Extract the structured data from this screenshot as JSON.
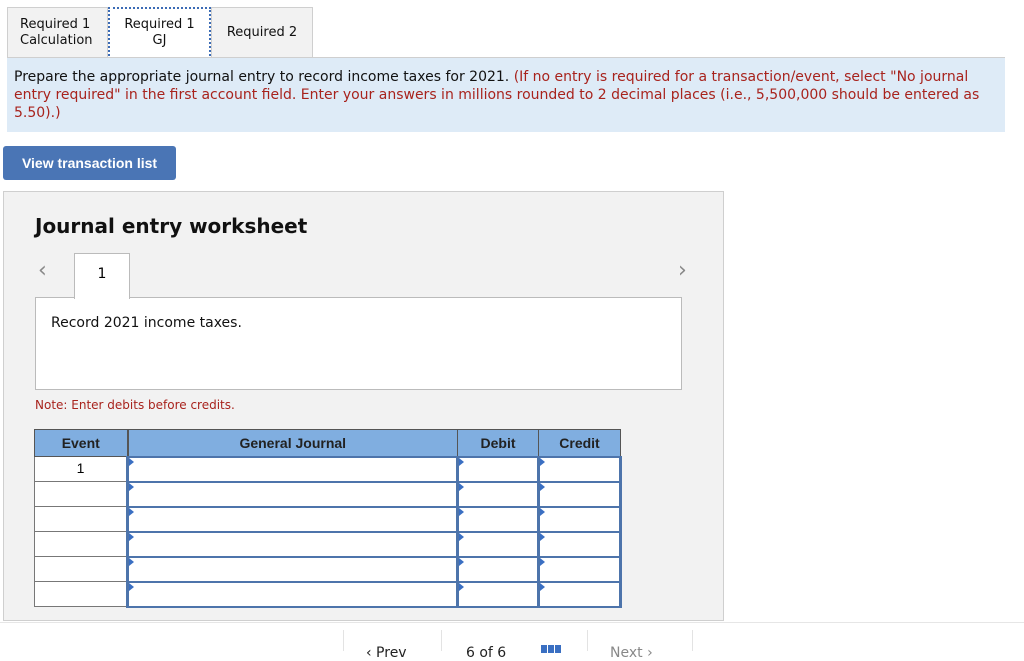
{
  "tabs": [
    {
      "label": "Required 1 Calculation",
      "active": false
    },
    {
      "label": "Required 1 GJ",
      "active": true
    },
    {
      "label": "Required 2",
      "active": false
    }
  ],
  "instructions": {
    "main": "Prepare the appropriate journal entry to record income taxes for 2021.",
    "note": "(If no entry is required for a transaction/event, select \"No journal entry required\" in the first account field. Enter your answers in millions rounded to 2 decimal places (i.e., 5,500,000 should be entered as 5.50).)"
  },
  "view_transaction_button": "View transaction list",
  "worksheet": {
    "title": "Journal entry worksheet",
    "prev_icon": "chevron-left-icon",
    "next_icon": "chevron-right-icon",
    "prev_glyph": "‹",
    "next_glyph": "›",
    "entry_tab": "1",
    "description": "Record 2021 income taxes.",
    "note": "Note: Enter debits before credits.",
    "table": {
      "headers": {
        "event": "Event",
        "general_journal": "General Journal",
        "debit": "Debit",
        "credit": "Credit"
      },
      "rows": [
        {
          "event": "1",
          "account": "",
          "debit": "",
          "credit": ""
        },
        {
          "event": "",
          "account": "",
          "debit": "",
          "credit": ""
        },
        {
          "event": "",
          "account": "",
          "debit": "",
          "credit": ""
        },
        {
          "event": "",
          "account": "",
          "debit": "",
          "credit": ""
        },
        {
          "event": "",
          "account": "",
          "debit": "",
          "credit": ""
        },
        {
          "event": "",
          "account": "",
          "debit": "",
          "credit": ""
        }
      ]
    }
  },
  "bottom_nav": {
    "prev": "‹ Prev",
    "page": "6 of 6",
    "next": "Next ›"
  }
}
